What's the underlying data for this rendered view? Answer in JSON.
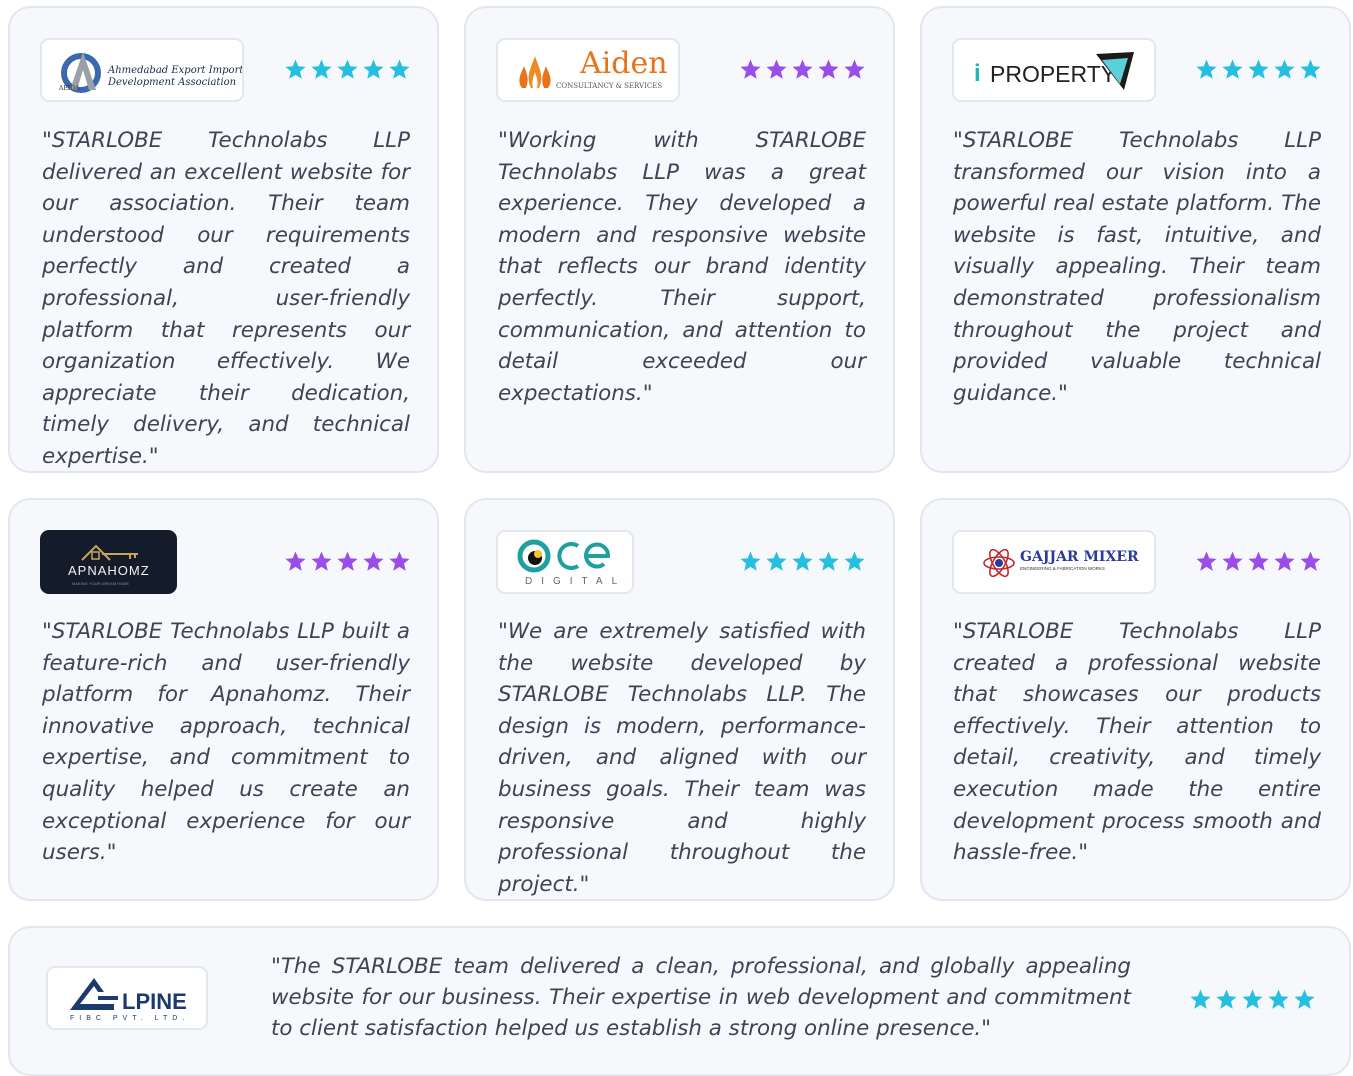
{
  "colors": {
    "star_cyan": "#27bfe0",
    "star_purple": "#9b4de8",
    "card_bg": "#f6f8fb",
    "card_border": "#e2e7ef",
    "quote_text": "#3d4452"
  },
  "testimonials": [
    {
      "logo": {
        "line1": "Ahmedabad Export Import",
        "line2": "Development Association",
        "mark": "AEIDA"
      },
      "rating": 5,
      "star_color": "cyan",
      "quote": "\"STARLOBE Technolabs LLP delivered an excellent website for our association. Their team understood our requirements perfectly and created a professional, user-friendly platform that represents our organization effectively. We appreciate their dedication, timely delivery, and technical expertise.\""
    },
    {
      "logo": {
        "name": "Aiden",
        "sub": "CONSULTANCY & SERVICES"
      },
      "rating": 5,
      "star_color": "purple",
      "quote": "\"Working with STARLOBE Technolabs LLP was a great experience. They developed a modern and responsive website that reflects our brand identity perfectly. Their support, communication, and attention to detail exceeded our expectations.\""
    },
    {
      "logo": {
        "i": "i",
        "name": "PROPERTY"
      },
      "rating": 5,
      "star_color": "cyan",
      "quote": "\"STARLOBE Technolabs LLP transformed our vision into a powerful real estate platform. The website is fast, intuitive, and visually appealing. Their team demonstrated professionalism throughout the project and provided valuable technical guidance.\""
    },
    {
      "logo": {
        "name": "APNAHOMZ",
        "tagline": "MAKING YOUR DREAM HOME"
      },
      "rating": 5,
      "star_color": "purple",
      "quote": "\"STARLOBE Technolabs LLP built a feature-rich and user-friendly platform for Apnahomz. Their innovative approach, technical expertise, and commitment to quality helped us create an exceptional experience for our users.\""
    },
    {
      "logo": {
        "name": "ace",
        "sub": "DIGITAL"
      },
      "rating": 5,
      "star_color": "cyan",
      "quote": "\"We are extremely satisfied with the website developed by STARLOBE Technolabs LLP. The design is modern, performance-driven, and aligned with our business goals. Their team was responsive and highly professional throughout the project.\""
    },
    {
      "logo": {
        "name": "GAJJAR MIXER",
        "sub": "ENGINEERING & FABRICATION WORKS"
      },
      "rating": 5,
      "star_color": "purple",
      "quote": "\"STARLOBE Technolabs LLP created a professional website that showcases our products effectively. Their attention to detail, creativity, and timely execution made the entire development process smooth and hassle-free.\""
    },
    {
      "logo": {
        "name": "LPINE",
        "sub": "FIBC PVT. LTD."
      },
      "rating": 5,
      "star_color": "cyan",
      "quote": "\"The STARLOBE team delivered a clean, professional, and globally appealing website for our business. Their expertise in web development and commitment to client satisfaction helped us establish a strong online presence.\""
    }
  ]
}
